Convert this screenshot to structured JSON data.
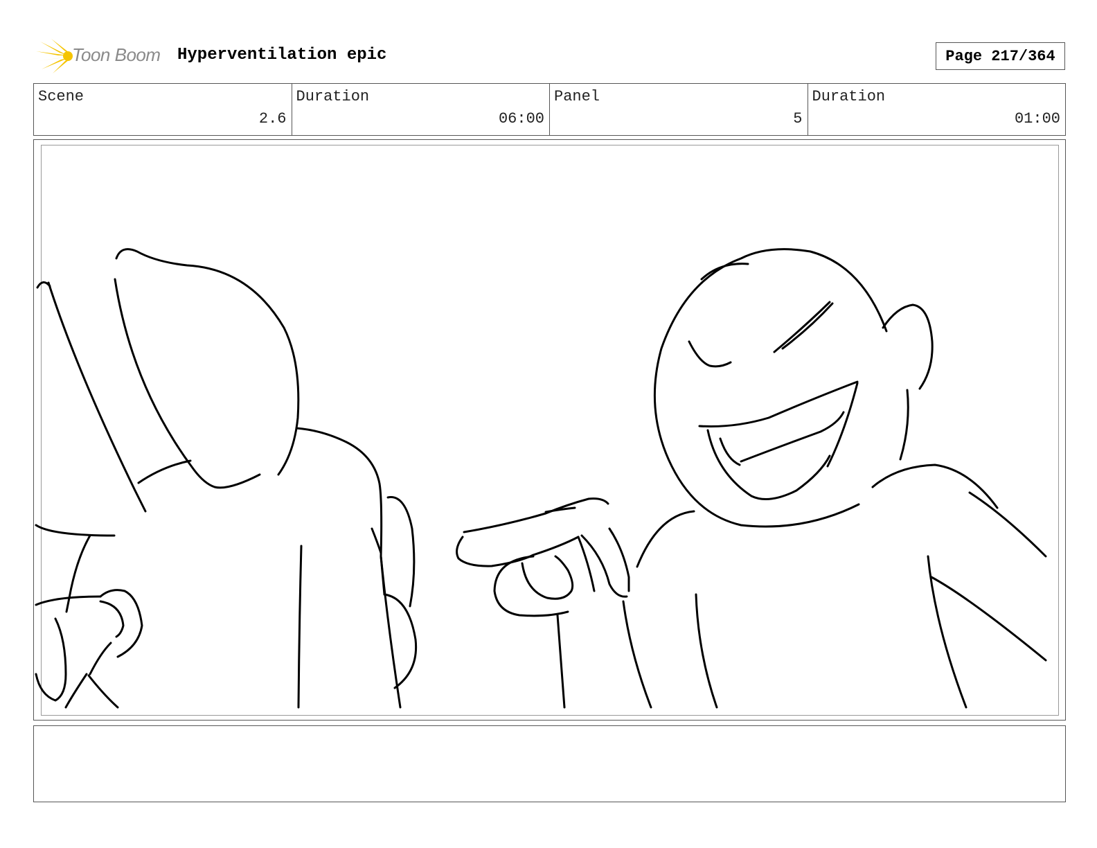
{
  "header": {
    "logo_text": "Toon Boom",
    "project_title": "Hyperventilation epic",
    "page_label": "Page 217/364"
  },
  "info": [
    {
      "label": "Scene",
      "value": "2.6"
    },
    {
      "label": "Duration",
      "value": "06:00"
    },
    {
      "label": "Panel",
      "value": "5"
    },
    {
      "label": "Duration",
      "value": "01:00"
    }
  ],
  "colors": {
    "logo_accent": "#f5c400",
    "border": "#555555"
  },
  "notes": ""
}
